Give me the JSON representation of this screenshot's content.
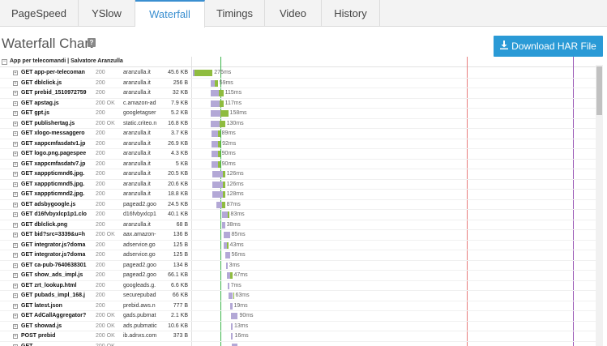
{
  "tabs": [
    {
      "label": "PageSpeed",
      "active": false
    },
    {
      "label": "YSlow",
      "active": false
    },
    {
      "label": "Waterfall",
      "active": true
    },
    {
      "label": "Timings",
      "active": false
    },
    {
      "label": "Video",
      "active": false
    },
    {
      "label": "History",
      "active": false
    }
  ],
  "header": {
    "title": "Waterfall Chart",
    "help": "?",
    "download_label": "Download HAR File"
  },
  "waterfall": {
    "group_label": "App per telecomandi | Salvatore Aranzulla",
    "colors": {
      "wait": "#b3a8d6",
      "receive": "#8fbc3f",
      "dom_line": "#3bb54a",
      "load_line": "#e87e7e",
      "onload_line": "#9b59b6"
    },
    "requests": [
      {
        "url": "GET app-per-telecoman",
        "status": "200",
        "domain": "aranzulla.it",
        "size": "45.6 KB",
        "time": "276ms"
      },
      {
        "url": "GET dblclick.js",
        "status": "200",
        "domain": "aranzulla.it",
        "size": "256 B",
        "time": "59ms"
      },
      {
        "url": "GET prebid_1510972759",
        "status": "200",
        "domain": "aranzulla.it",
        "size": "32 KB",
        "time": "115ms"
      },
      {
        "url": "GET apstag.js",
        "status": "200 OK",
        "domain": "c.amazon-ad",
        "size": "7.9 KB",
        "time": "117ms"
      },
      {
        "url": "GET gpt.js",
        "status": "200",
        "domain": "googletagser",
        "size": "5.2 KB",
        "time": "158ms"
      },
      {
        "url": "GET publishertag.js",
        "status": "200 OK",
        "domain": "static.criteo.n",
        "size": "16.8 KB",
        "time": "130ms"
      },
      {
        "url": "GET xlogo-messaggero",
        "status": "200",
        "domain": "aranzulla.it",
        "size": "3.7 KB",
        "time": "89ms"
      },
      {
        "url": "GET xappcmfasdatv1.jp",
        "status": "200",
        "domain": "aranzulla.it",
        "size": "26.9 KB",
        "time": "92ms"
      },
      {
        "url": "GET logo.png.pagespee",
        "status": "200",
        "domain": "aranzulla.it",
        "size": "4.3 KB",
        "time": "90ms"
      },
      {
        "url": "GET xappcmfasdatv7.jp",
        "status": "200",
        "domain": "aranzulla.it",
        "size": "5 KB",
        "time": "90ms"
      },
      {
        "url": "GET xapppticmnd6.jpg.",
        "status": "200",
        "domain": "aranzulla.it",
        "size": "20.5 KB",
        "time": "126ms"
      },
      {
        "url": "GET xapppticmnd5.jpg.",
        "status": "200",
        "domain": "aranzulla.it",
        "size": "20.6 KB",
        "time": "126ms"
      },
      {
        "url": "GET xapppticmnd2.jpg.",
        "status": "200",
        "domain": "aranzulla.it",
        "size": "18.8 KB",
        "time": "128ms"
      },
      {
        "url": "GET adsbygoogle.js",
        "status": "200",
        "domain": "pagead2.goo",
        "size": "24.5 KB",
        "time": "87ms"
      },
      {
        "url": "GET d16fvbyxlcp1p1.clo",
        "status": "200",
        "domain": "d16fvbyxlcp1",
        "size": "40.1 KB",
        "time": "83ms"
      },
      {
        "url": "GET dblclick.png",
        "status": "200",
        "domain": "aranzulla.it",
        "size": "68 B",
        "time": "38ms"
      },
      {
        "url": "GET bid?src=3339&u=h",
        "status": "200 OK",
        "domain": "aax.amazon-",
        "size": "136 B",
        "time": "85ms"
      },
      {
        "url": "GET integrator.js?doma",
        "status": "200",
        "domain": "adservice.go",
        "size": "125 B",
        "time": "43ms"
      },
      {
        "url": "GET integrator.js?doma",
        "status": "200",
        "domain": "adservice.go",
        "size": "125 B",
        "time": "56ms"
      },
      {
        "url": "GET ca-pub-7640638301",
        "status": "200",
        "domain": "pagead2.goo",
        "size": "134 B",
        "time": "3ms"
      },
      {
        "url": "GET show_ads_impl.js",
        "status": "200",
        "domain": "pagead2.goo",
        "size": "66.1 KB",
        "time": "47ms"
      },
      {
        "url": "GET zrt_lookup.html",
        "status": "200",
        "domain": "googleads.g.",
        "size": "6.6 KB",
        "time": "7ms"
      },
      {
        "url": "GET pubads_impl_168.j",
        "status": "200",
        "domain": "securepubad",
        "size": "66 KB",
        "time": "63ms"
      },
      {
        "url": "GET latest.json",
        "status": "200",
        "domain": "prebid.aws.n",
        "size": "777 B",
        "time": "19ms"
      },
      {
        "url": "GET AdCallAggregator?",
        "status": "200 OK",
        "domain": "gads.pubmat",
        "size": "2.1 KB",
        "time": "90ms"
      },
      {
        "url": "GET showad.js",
        "status": "200 OK",
        "domain": "ads.pubmatic",
        "size": "10.6 KB",
        "time": "13ms"
      },
      {
        "url": "POST prebid",
        "status": "200 OK",
        "domain": "ib.adnxs.com",
        "size": "373 B",
        "time": "16ms"
      },
      {
        "url": "GET ",
        "status": "200 OK",
        "domain": "",
        "size": "",
        "time": ""
      }
    ],
    "timing": [
      {
        "start": 0.0,
        "wait": 0.0,
        "recv": 0.045
      },
      {
        "start": 0.044,
        "wait": 0.01,
        "recv": 0.008
      },
      {
        "start": 0.044,
        "wait": 0.02,
        "recv": 0.012
      },
      {
        "start": 0.044,
        "wait": 0.022,
        "recv": 0.01
      },
      {
        "start": 0.044,
        "wait": 0.024,
        "recv": 0.02
      },
      {
        "start": 0.044,
        "wait": 0.022,
        "recv": 0.014
      },
      {
        "start": 0.046,
        "wait": 0.016,
        "recv": 0.006
      },
      {
        "start": 0.046,
        "wait": 0.016,
        "recv": 0.007
      },
      {
        "start": 0.046,
        "wait": 0.016,
        "recv": 0.006
      },
      {
        "start": 0.046,
        "wait": 0.016,
        "recv": 0.006
      },
      {
        "start": 0.048,
        "wait": 0.026,
        "recv": 0.006
      },
      {
        "start": 0.048,
        "wait": 0.026,
        "recv": 0.006
      },
      {
        "start": 0.048,
        "wait": 0.026,
        "recv": 0.006
      },
      {
        "start": 0.058,
        "wait": 0.014,
        "recv": 0.008
      },
      {
        "start": 0.072,
        "wait": 0.014,
        "recv": 0.004
      },
      {
        "start": 0.072,
        "wait": 0.008,
        "recv": 0.0
      },
      {
        "start": 0.076,
        "wait": 0.016,
        "recv": 0.0
      },
      {
        "start": 0.076,
        "wait": 0.008,
        "recv": 0.004
      },
      {
        "start": 0.08,
        "wait": 0.012,
        "recv": 0.0
      },
      {
        "start": 0.082,
        "wait": 0.002,
        "recv": 0.0
      },
      {
        "start": 0.084,
        "wait": 0.008,
        "recv": 0.006
      },
      {
        "start": 0.086,
        "wait": 0.003,
        "recv": 0.0
      },
      {
        "start": 0.088,
        "wait": 0.012,
        "recv": 0.002
      },
      {
        "start": 0.092,
        "wait": 0.006,
        "recv": 0.0
      },
      {
        "start": 0.094,
        "wait": 0.018,
        "recv": 0.0
      },
      {
        "start": 0.094,
        "wait": 0.005,
        "recv": 0.0
      },
      {
        "start": 0.094,
        "wait": 0.006,
        "recv": 0.0
      },
      {
        "start": 0.096,
        "wait": 0.016,
        "recv": 0.0
      }
    ],
    "markers": {
      "dom": 0.068,
      "load": 0.682,
      "onload": 0.948
    }
  }
}
